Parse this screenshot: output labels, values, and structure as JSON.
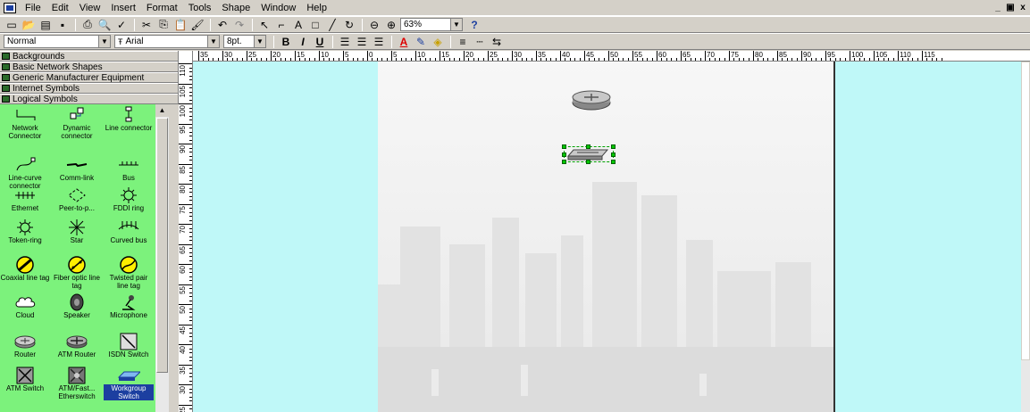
{
  "menubar": {
    "items": [
      "File",
      "Edit",
      "View",
      "Insert",
      "Format",
      "Tools",
      "Shape",
      "Window",
      "Help"
    ],
    "window_buttons": [
      "_",
      "ё",
      "x"
    ]
  },
  "toolbar": {
    "zoom_value": "63%",
    "style_value": "Normal",
    "font_value": "Arial",
    "font_size_value": "8pt.",
    "bold": "B",
    "italic": "I",
    "underline": "U",
    "text_tool": "A",
    "help": "?"
  },
  "stencils": {
    "headers": [
      "Backgrounds",
      "Basic Network Shapes",
      "Generic Manufacturer Equipment",
      "Internet Symbols",
      "Logical Symbols"
    ],
    "shapes": [
      {
        "label": "Network Connector",
        "icon": "network-connector-icon"
      },
      {
        "label": "Dynamic connector",
        "icon": "dynamic-connector-icon"
      },
      {
        "label": "Line connector",
        "icon": "line-connector-icon"
      },
      {
        "label": "Line-curve connector",
        "icon": "line-curve-connector-icon"
      },
      {
        "label": "Comm-link",
        "icon": "comm-link-icon"
      },
      {
        "label": "Bus",
        "icon": "bus-icon"
      },
      {
        "label": "Ethernet",
        "icon": "ethernet-icon"
      },
      {
        "label": "Peer-to-p...",
        "icon": "peer-to-peer-icon"
      },
      {
        "label": "FDDI ring",
        "icon": "fddi-ring-icon"
      },
      {
        "label": "Token-ring",
        "icon": "token-ring-icon"
      },
      {
        "label": "Star",
        "icon": "star-icon"
      },
      {
        "label": "Curved bus",
        "icon": "curved-bus-icon"
      },
      {
        "label": "Coaxial line tag",
        "icon": "coaxial-tag-icon"
      },
      {
        "label": "Fiber optic line tag",
        "icon": "fiber-optic-tag-icon"
      },
      {
        "label": "Twisted pair line tag",
        "icon": "twisted-pair-tag-icon"
      },
      {
        "label": "Cloud",
        "icon": "cloud-icon"
      },
      {
        "label": "Speaker",
        "icon": "speaker-icon"
      },
      {
        "label": "Microphone",
        "icon": "microphone-icon"
      },
      {
        "label": "Router",
        "icon": "router-icon"
      },
      {
        "label": "ATM Router",
        "icon": "atm-router-icon"
      },
      {
        "label": "ISDN Switch",
        "icon": "isdn-switch-icon"
      },
      {
        "label": "ATM Switch",
        "icon": "atm-switch-icon"
      },
      {
        "label": "ATM/Fast... Etherswitch",
        "icon": "atm-etherswitch-icon"
      },
      {
        "label": "Workgroup Switch",
        "icon": "workgroup-switch-icon"
      }
    ]
  },
  "rulers": {
    "h_ticks": [
      "35",
      "30",
      "25",
      "20",
      "15",
      "10",
      "5",
      "0",
      "5",
      "10",
      "15",
      "20",
      "25",
      "30",
      "35",
      "40",
      "45",
      "50",
      "55",
      "60",
      "65",
      "70",
      "75",
      "80",
      "85",
      "90",
      "95",
      "100",
      "105",
      "110",
      "115"
    ],
    "v_ticks": [
      "110",
      "105",
      "100",
      "95",
      "90",
      "85",
      "80",
      "75",
      "70",
      "65",
      "60",
      "55",
      "50",
      "45",
      "40",
      "35",
      "30",
      "25"
    ]
  },
  "colors": {
    "stencil_bg": "#7cf27c",
    "canvas_bg": "#bff8f8",
    "selection": "#1c3fa0",
    "handle": "#00c800"
  }
}
